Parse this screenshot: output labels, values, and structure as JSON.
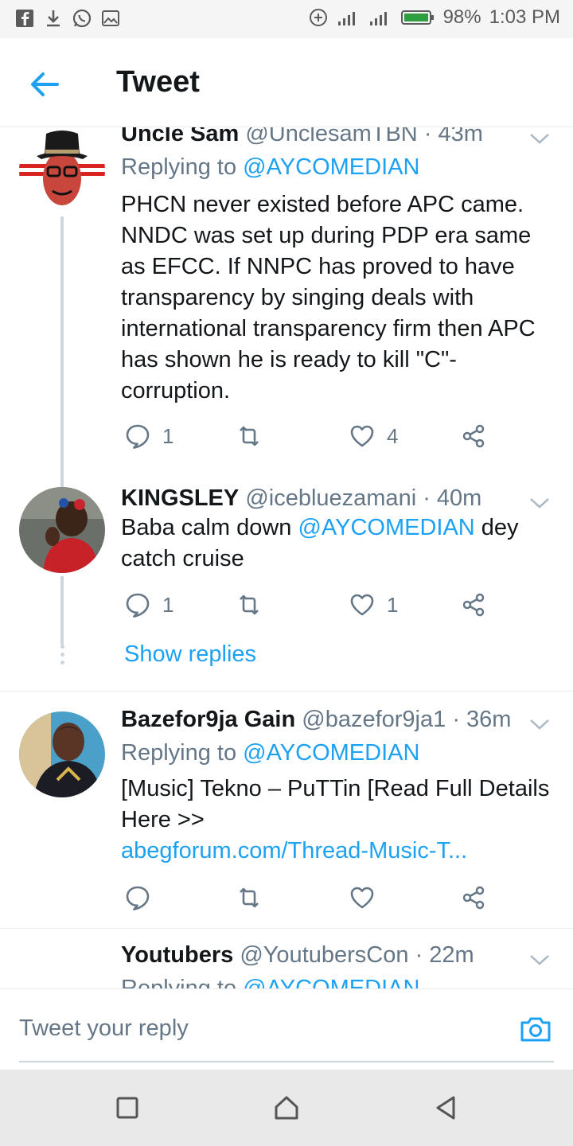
{
  "status_bar": {
    "left_icons": [
      "facebook-icon",
      "download-icon",
      "whatsapp-icon",
      "gallery-icon"
    ],
    "right_icons": [
      "add-circle-icon",
      "signal-icon",
      "signal-icon",
      "battery-icon"
    ],
    "battery": "98%",
    "time": "1:03 PM"
  },
  "header": {
    "title": "Tweet"
  },
  "tweets": [
    {
      "name": "Uncle Sam",
      "handle": "@UnclesamTBN",
      "time": "· 43m",
      "replying_prefix": "Replying to",
      "replying_to": "@AYCOMEDIAN",
      "text": "PHCN never existed before APC came. NNDC was set up during PDP era same as EFCC. If NNPC has proved to have transparency by singing deals with international transparency firm then APC has shown he is ready to kill \"C\"-corruption.",
      "replies": "1",
      "retweets": "",
      "likes": "4"
    },
    {
      "name": "KINGSLEY",
      "handle": "@icebluezamani",
      "time": "· 40m",
      "text_before": "Baba calm down",
      "mention": "@AYCOMEDIAN",
      "text_after": "dey catch cruise",
      "replies": "1",
      "retweets": "",
      "likes": "1",
      "show_replies": "Show replies"
    },
    {
      "name": "Bazefor9ja Gain",
      "handle": "@bazefor9ja1",
      "time": "· 36m",
      "replying_prefix": "Replying to",
      "replying_to": "@AYCOMEDIAN",
      "text": "[Music] Tekno – PuTTin [Read Full Details Here >>",
      "link": "abegforum.com/Thread-Music-T...",
      "replies": "",
      "retweets": "",
      "likes": ""
    },
    {
      "name": "Youtubers",
      "handle": "@YoutubersCon",
      "time": "· 22m",
      "replying_prefix": "Replying to",
      "replying_to": "@AYCOMEDIAN"
    }
  ],
  "reply_bar": {
    "placeholder": "Tweet your reply"
  },
  "colors": {
    "accent": "#1da1f2",
    "text": "#14171a",
    "muted": "#657786",
    "divider": "#e6ecf0"
  }
}
